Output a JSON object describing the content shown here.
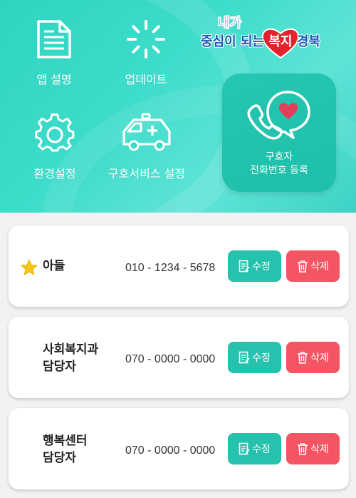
{
  "colors": {
    "header_teal": "#2fd4bf",
    "guardian_button": "#25c7b2",
    "edit_button": "#25c2ad",
    "delete_button": "#f35563",
    "star": "#f5c518"
  },
  "logo": {
    "line1": "내가",
    "line2_part1": "중심이 되는 ",
    "line2_part2": "복지",
    "line2_part3": " 경북"
  },
  "menu": {
    "app_guide": "앱 설명",
    "update": "업데이트",
    "settings": "환경설정",
    "guardian_service": "구호서비스 설정",
    "register_line1": "구호자",
    "register_line2": "전화번호 등록"
  },
  "icons": {
    "app_guide": "document-icon",
    "update": "loading-spinner-icon",
    "settings": "gear-icon",
    "guardian_service": "ambulance-icon",
    "register": "phone-heart-icon",
    "edit": "edit-document-icon",
    "delete": "trash-icon",
    "favorite": "star-icon"
  },
  "contacts": [
    {
      "name_line1": "아들",
      "name_line2": "",
      "phone": "010 - 1234 - 5678",
      "favorite": true,
      "edit_label": "수정",
      "delete_label": "삭제"
    },
    {
      "name_line1": "사회복지과",
      "name_line2": "담당자",
      "phone": "070 - 0000 - 0000",
      "favorite": false,
      "edit_label": "수정",
      "delete_label": "삭제"
    },
    {
      "name_line1": "행복센터",
      "name_line2": "담당자",
      "phone": "070 - 0000 - 0000",
      "favorite": false,
      "edit_label": "수정",
      "delete_label": "삭제"
    }
  ]
}
